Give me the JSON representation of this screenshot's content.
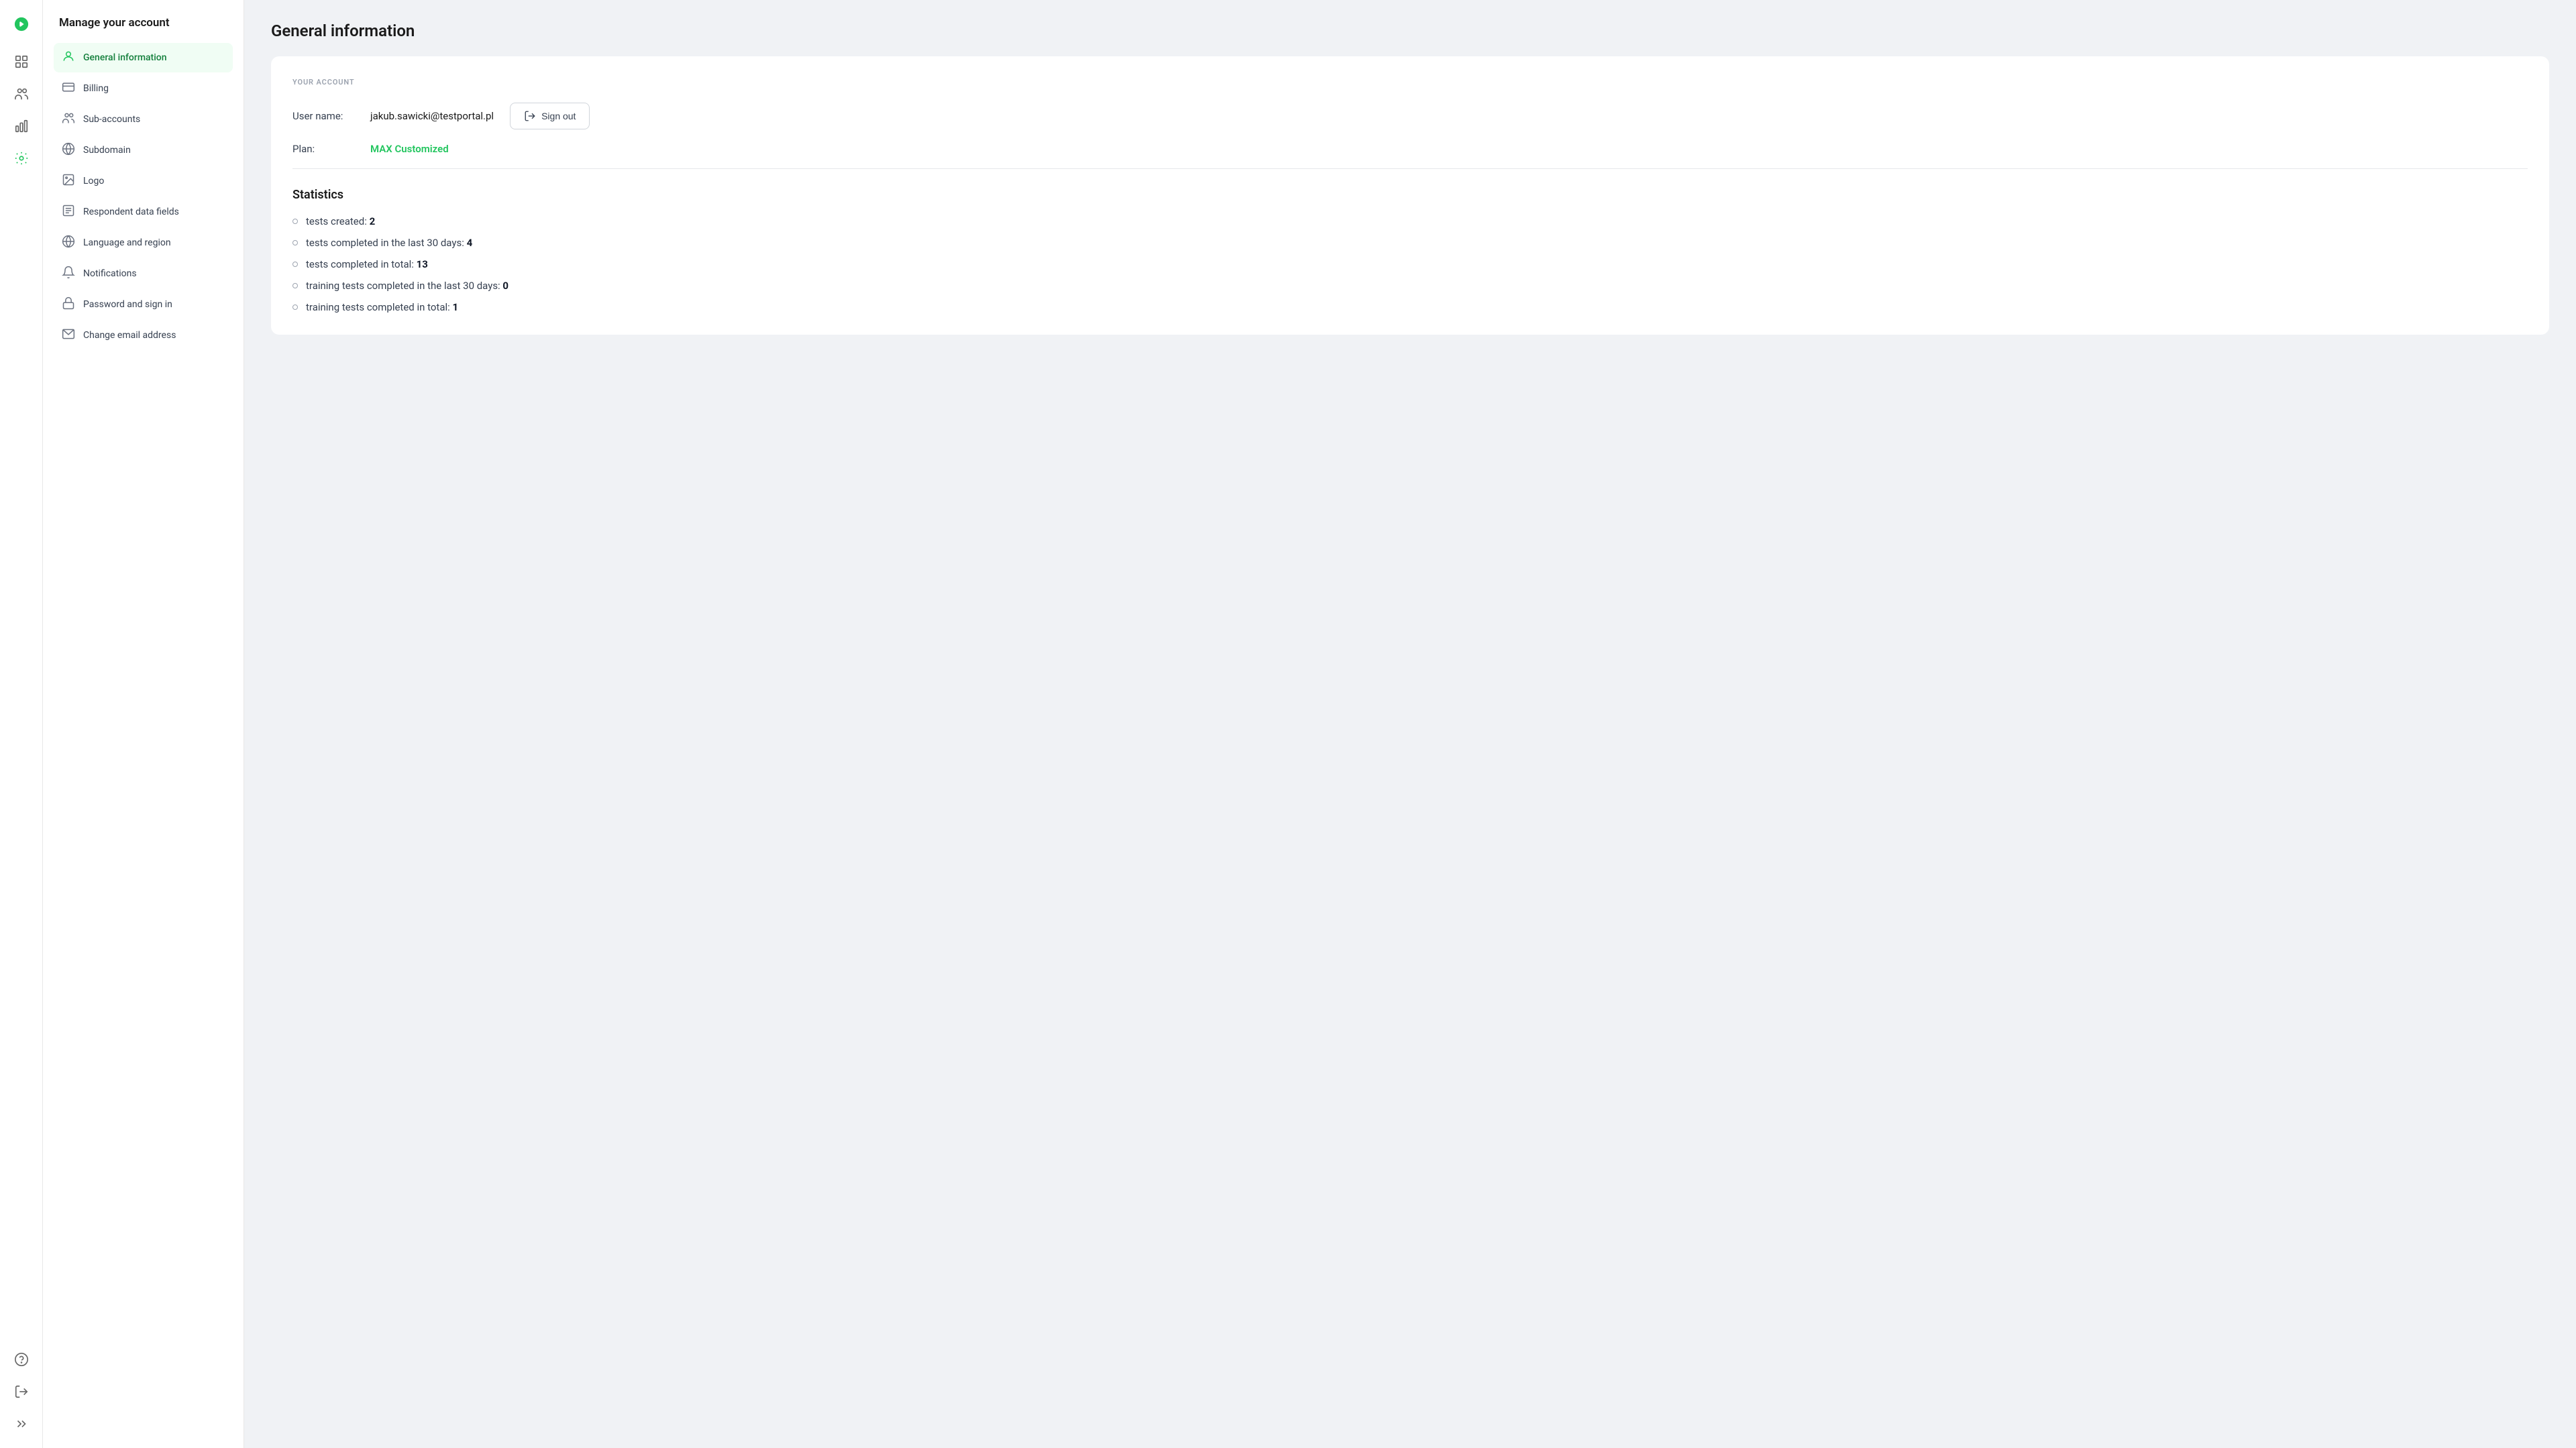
{
  "sidebar": {
    "title": "Manage your account",
    "items": [
      {
        "id": "general-information",
        "label": "General information",
        "active": true
      },
      {
        "id": "billing",
        "label": "Billing",
        "active": false
      },
      {
        "id": "sub-accounts",
        "label": "Sub-accounts",
        "active": false
      },
      {
        "id": "subdomain",
        "label": "Subdomain",
        "active": false
      },
      {
        "id": "logo",
        "label": "Logo",
        "active": false
      },
      {
        "id": "respondent-data-fields",
        "label": "Respondent data fields",
        "active": false
      },
      {
        "id": "language-and-region",
        "label": "Language and region",
        "active": false
      },
      {
        "id": "notifications",
        "label": "Notifications",
        "active": false
      },
      {
        "id": "password-and-sign-in",
        "label": "Password and sign in",
        "active": false
      },
      {
        "id": "change-email-address",
        "label": "Change email address",
        "active": false
      }
    ]
  },
  "page": {
    "title": "General information",
    "section_label": "YOUR ACCOUNT",
    "username_label": "User name:",
    "username_value": "jakub.sawicki@testportal.pl",
    "plan_label": "Plan:",
    "plan_value": "MAX Customized",
    "sign_out_label": "Sign out",
    "statistics": {
      "title": "Statistics",
      "items": [
        {
          "text": "tests created: ",
          "bold": "2"
        },
        {
          "text": "tests completed in the last 30 days: ",
          "bold": "4"
        },
        {
          "text": "tests completed in total: ",
          "bold": "13"
        },
        {
          "text": "training tests completed in the last 30 days: ",
          "bold": "0"
        },
        {
          "text": "training tests completed in total: ",
          "bold": "1"
        }
      ]
    }
  }
}
